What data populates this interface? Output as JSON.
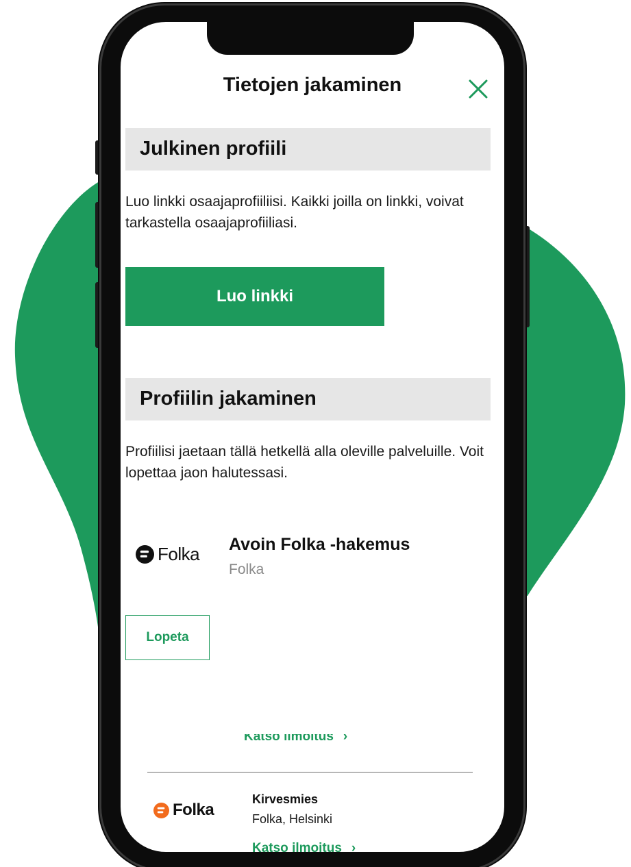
{
  "colors": {
    "accent": "#1d9a5c",
    "header_bg": "#e6e6e6",
    "text": "#111111",
    "muted": "#8a8a8a",
    "folka_orange": "#f26b1d"
  },
  "modal": {
    "title": "Tietojen jakaminen",
    "close_icon": "close-icon"
  },
  "public_profile": {
    "heading": "Julkinen profiili",
    "description": "Luo linkki osaajaprofiiliisi. Kaikki joilla on linkki, voivat tarkastella osaajaprofiiliasi.",
    "create_link_label": "Luo linkki"
  },
  "profile_sharing": {
    "heading": "Profiilin jakaminen",
    "description": "Profiilisi jaetaan tällä hetkellä alla oleville palveluille. Voit lopettaa jaon halutessasi.",
    "services": [
      {
        "logo_text": "Folka",
        "logo_icon": "folka-logo-icon",
        "name": "Avoin Folka -hakemus",
        "provider": "Folka",
        "stop_label": "Lopeta"
      }
    ]
  },
  "background_page": {
    "view_listing_label": "Katso ilmoitus",
    "job": {
      "logo_text": "Folka",
      "title": "Kirvesmies",
      "company": "Folka, Helsinki",
      "view_listing_label": "Katso ilmoitus"
    }
  }
}
